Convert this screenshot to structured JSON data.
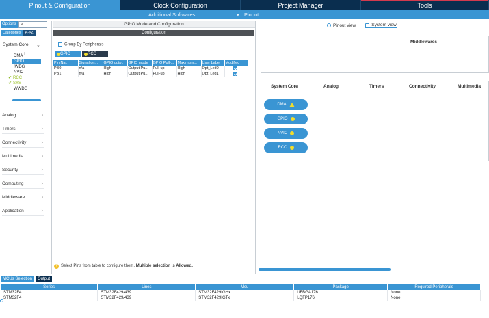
{
  "top_tabs": [
    "Pinout & Configuration",
    "Clock Configuration",
    "Project Manager",
    "Tools"
  ],
  "sub_bar": {
    "additional": "Additional Softwares",
    "pinout": "Pinout",
    "pinout_chevron": "▾"
  },
  "left": {
    "options": "Options",
    "categories": "Categories",
    "az": "A->Z",
    "system_core": "System Core",
    "system_items": [
      "DMA",
      "GPIO",
      "IWDG",
      "NVIC",
      "RCC",
      "SYS",
      "WWDG"
    ],
    "groups": [
      "Analog",
      "Timers",
      "Connectivity",
      "Multimedia",
      "Security",
      "Computing",
      "Middleware",
      "Application"
    ]
  },
  "center": {
    "title": "GPIO Mode and Configuration",
    "configuration": "Configuration",
    "group_by": "Group By Peripherals",
    "subtabs": [
      "GPIO",
      "RCC"
    ],
    "columns": [
      "Pin Na...",
      "Signal on...",
      "GPIO outp...",
      "GPIO mode",
      "GPIO Pull-...",
      "Maximum...",
      "User Label",
      "Modified"
    ],
    "rows": [
      [
        "PB0",
        "n/a",
        "High",
        "Output Pu...",
        "Pull-up",
        "High",
        "Opt_Led0",
        ""
      ],
      [
        "PB1",
        "n/a",
        "High",
        "Output Pu...",
        "Pull-up",
        "High",
        "Opt_Led1",
        ""
      ]
    ],
    "hint_normal": "Select Pins from table to configure them.",
    "hint_bold": "Multiple selection is Allowed."
  },
  "right": {
    "view_tabs": [
      "Pinout view",
      "System view"
    ],
    "middlewares": "Middlewares",
    "categories": [
      "System Core",
      "Analog",
      "Timers",
      "Connectivity",
      "Multimedia"
    ],
    "pills": [
      "DMA",
      "GPIO",
      "NVIC",
      "RCC"
    ]
  },
  "bottom": {
    "tabs": [
      "MCUs Selection",
      "Output"
    ],
    "columns": [
      "Series",
      "Lines",
      "Mcu",
      "Package",
      "Required Peripherals"
    ],
    "rows": [
      [
        "STM32F4",
        "STM32F429/439",
        "STM32F429IGHx",
        "UFBGA176",
        "None"
      ],
      [
        "STM32F4",
        "STM32F429/439",
        "STM32F429IGTx",
        "LQFP176",
        "None"
      ]
    ]
  },
  "colors": {
    "accent": "#3a95d3",
    "dark": "#0a2e4f",
    "warning": "#f2dd2c",
    "ok_green": "#8ab822"
  }
}
